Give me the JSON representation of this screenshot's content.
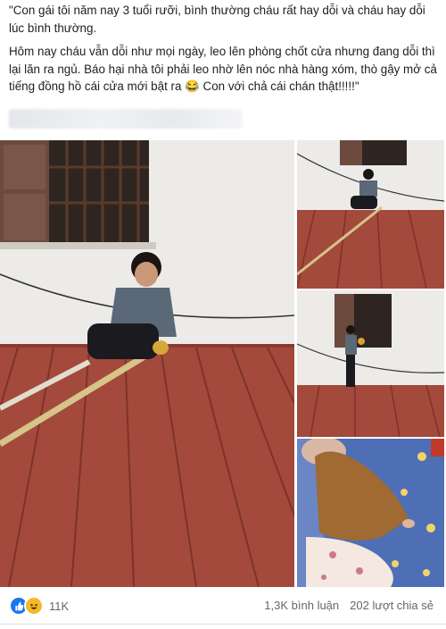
{
  "post": {
    "paragraph1": "\"Con gái tôi năm nay 3 tuổi rưỡi, bình thường cháu rất hay dỗi và cháu hay dỗi lúc bình thường.",
    "paragraph2": "Hôm nay cháu vẫn dỗi như mọi ngày, leo lên phòng chốt cửa nhưng đang dỗi thì lại lăn ra ngủ. Báo hại nhà tôi phải leo nhờ lên nóc nhà hàng xóm, thò gậy mở cả tiếng đồng hồ cái cửa mới bật ra 😂 Con với chả cái chán thật!!!!!\""
  },
  "reactions": {
    "icons": [
      "like-icon",
      "haha-icon"
    ],
    "count": "11K",
    "like_color": "#1877f2",
    "haha_color": "#f7b928"
  },
  "stats": {
    "comments": "1,3K bình luận",
    "shares": "202 lượt chia sẻ"
  }
}
